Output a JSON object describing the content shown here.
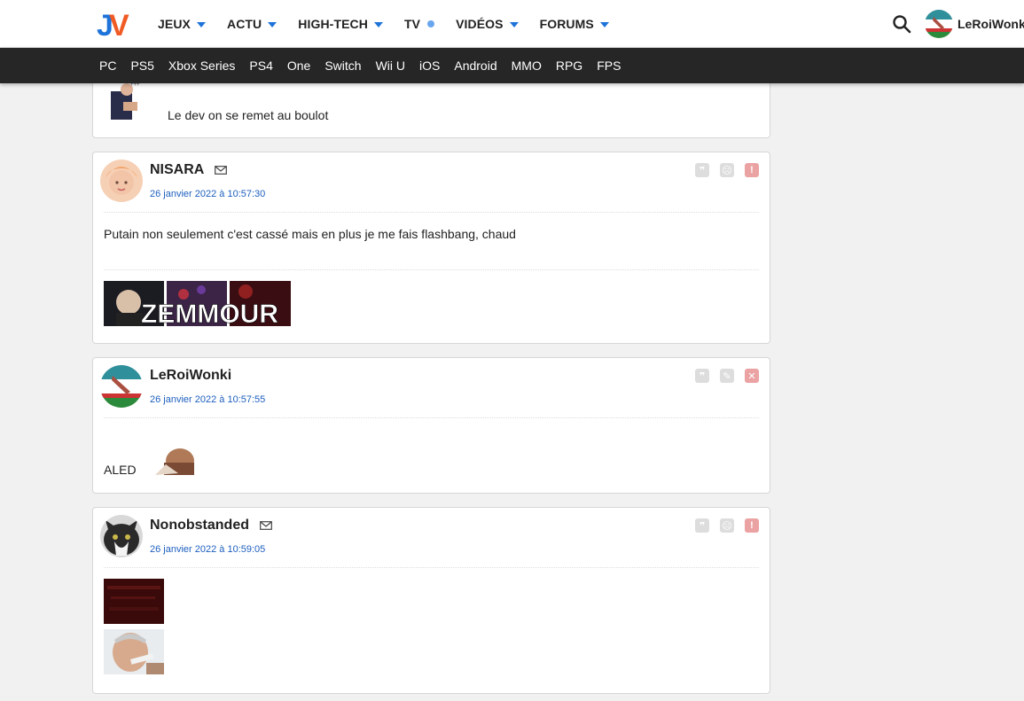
{
  "header": {
    "logo_text": "JV",
    "nav": [
      {
        "label": "JEUX",
        "marker": "caret"
      },
      {
        "label": "ACTU",
        "marker": "caret"
      },
      {
        "label": "HIGH-TECH",
        "marker": "caret"
      },
      {
        "label": "TV",
        "marker": "dot"
      },
      {
        "label": "VIDÉOS",
        "marker": "caret"
      },
      {
        "label": "FORUMS",
        "marker": "caret"
      }
    ],
    "search_icon": "search-icon",
    "user_name": "LeRoiWonki"
  },
  "platforms": [
    "PC",
    "PS5",
    "Xbox Series",
    "PS4",
    "One",
    "Switch",
    "Wii U",
    "iOS",
    "Android",
    "MMO",
    "RPG",
    "FPS"
  ],
  "posts": [
    {
      "text": "Le dev on se remet au boulot"
    },
    {
      "author": "NISARA",
      "date": "26 janvier 2022 à 10:57:30",
      "text": "Putain non seulement c'est cassé mais en plus je me fais flashbang, chaud",
      "signature_text": "ZEMMOUR",
      "actions": [
        "quote-icon",
        "sad-icon",
        "report-icon"
      ]
    },
    {
      "author": "LeRoiWonki",
      "date": "26 janvier 2022 à 10:57:55",
      "text": "ALED",
      "actions": [
        "quote-icon",
        "edit-icon",
        "delete-icon"
      ]
    },
    {
      "author": "Nonobstanded",
      "date": "26 janvier 2022 à 10:59:05",
      "actions": [
        "quote-icon",
        "sad-icon",
        "report-icon"
      ]
    }
  ],
  "colors": {
    "accent": "#1d73d9",
    "date_link": "#1d5fbf",
    "platform_bar": "#262626",
    "report_red": "#eba2a2"
  }
}
